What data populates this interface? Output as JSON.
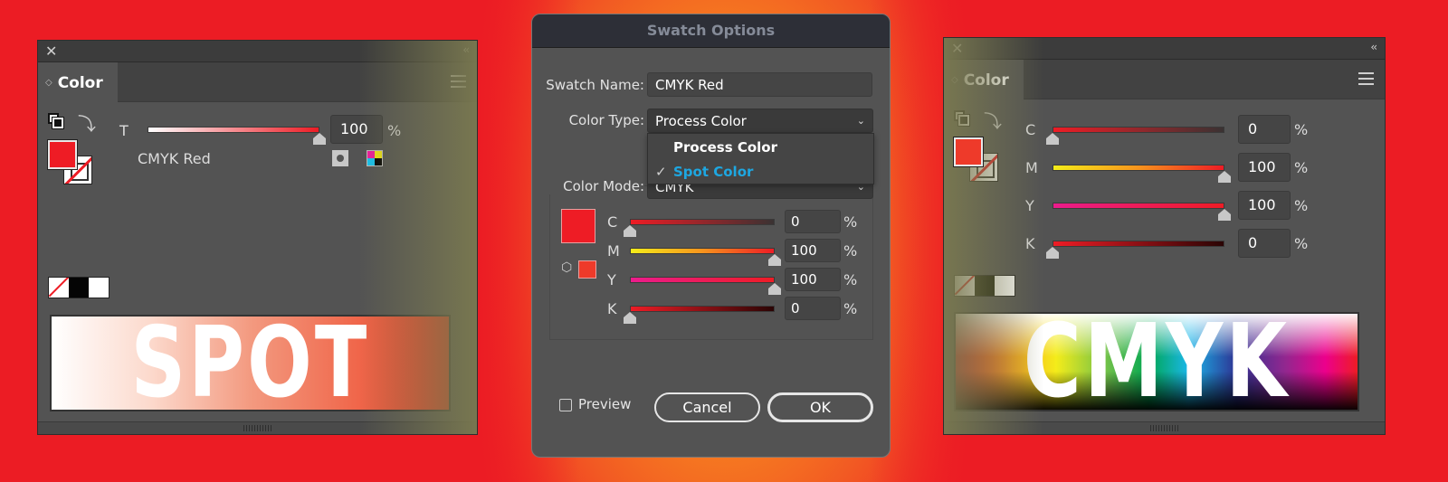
{
  "left_panel": {
    "tab_label": "Color",
    "tint_label": "T",
    "tint_value": "100",
    "tint_fraction": 1.0,
    "percent": "%",
    "swatch_name": "CMYK Red",
    "fill_color": "#ee1c25",
    "spectrum_word": "SPOT",
    "icons": [
      "close-icon",
      "collapse-icon",
      "panel-menu-icon",
      "fill-stroke-icon",
      "swap-icon",
      "spot-color-icon",
      "cmyk-icon"
    ]
  },
  "dialog": {
    "title": "Swatch Options",
    "swatch_name_label": "Swatch Name:",
    "swatch_name_value": "CMYK Red",
    "color_type_label": "Color Type:",
    "color_type_value": "Process Color",
    "color_type_options": [
      {
        "label": "Process Color",
        "checked": false
      },
      {
        "label": "Spot Color",
        "checked": true,
        "color": "#1ea7e1"
      }
    ],
    "check_glyph": "✓",
    "color_mode_label": "Color Mode:",
    "color_mode_value": "CMYK",
    "fill_color": "#ee1c25",
    "channels": [
      {
        "label": "C",
        "value": "0",
        "fraction": 0.0
      },
      {
        "label": "M",
        "value": "100",
        "fraction": 1.0
      },
      {
        "label": "Y",
        "value": "100",
        "fraction": 1.0
      },
      {
        "label": "K",
        "value": "0",
        "fraction": 0.0
      }
    ],
    "percent": "%",
    "preview_label": "Preview",
    "preview_checked": false,
    "cancel_label": "Cancel",
    "ok_label": "OK"
  },
  "right_panel": {
    "tab_label": "Color",
    "fill_color": "#ee3a2a",
    "channels": [
      {
        "label": "C",
        "value": "0",
        "fraction": 0.0
      },
      {
        "label": "M",
        "value": "100",
        "fraction": 1.0
      },
      {
        "label": "Y",
        "value": "100",
        "fraction": 1.0
      },
      {
        "label": "K",
        "value": "0",
        "fraction": 0.0
      }
    ],
    "percent": "%",
    "spectrum_word": "CMYK"
  }
}
